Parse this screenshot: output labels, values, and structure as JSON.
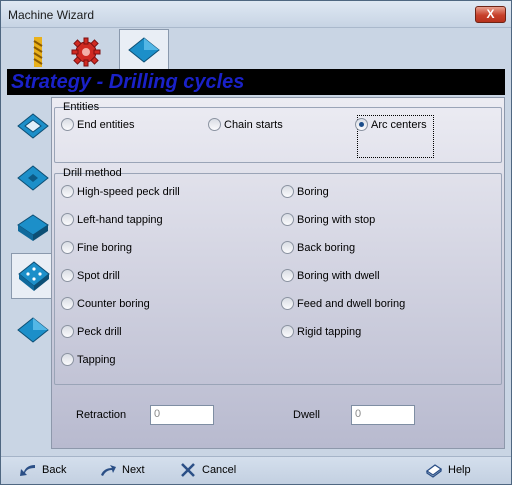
{
  "window": {
    "title": "Machine Wizard",
    "close_label": "X"
  },
  "top_tabs": [
    {
      "icon": "drill-bit-icon"
    },
    {
      "icon": "gear-icon"
    },
    {
      "icon": "blue-diamond-icon"
    }
  ],
  "header": {
    "title": "Strategy - Drilling cycles",
    "title_color": "#1a21c8"
  },
  "side_tabs": [
    {
      "icon": "contour-icon"
    },
    {
      "icon": "pocket-icon"
    },
    {
      "icon": "slot-icon"
    },
    {
      "icon": "drill-icon"
    },
    {
      "icon": "surface-icon"
    }
  ],
  "entities": {
    "legend": "Entities",
    "options": [
      {
        "label": "End entities",
        "checked": false
      },
      {
        "label": "Chain starts",
        "checked": false
      },
      {
        "label": "Arc centers",
        "checked": true
      }
    ]
  },
  "drill_method": {
    "legend": "Drill method",
    "left": [
      {
        "label": "High-speed peck drill"
      },
      {
        "label": "Left-hand tapping"
      },
      {
        "label": "Fine boring"
      },
      {
        "label": "Spot drill"
      },
      {
        "label": "Counter boring"
      },
      {
        "label": "Peck drill"
      },
      {
        "label": "Tapping"
      }
    ],
    "right": [
      {
        "label": "Boring"
      },
      {
        "label": "Boring with stop"
      },
      {
        "label": "Back boring"
      },
      {
        "label": "Boring with dwell"
      },
      {
        "label": "Feed and dwell boring"
      },
      {
        "label": "Rigid tapping"
      }
    ]
  },
  "fields": {
    "retraction_label": "Retraction",
    "retraction_value": "0",
    "dwell_label": "Dwell",
    "dwell_value": "0"
  },
  "footer": {
    "back_label": "Back",
    "next_label": "Next",
    "cancel_label": "Cancel",
    "help_label": "Help"
  }
}
